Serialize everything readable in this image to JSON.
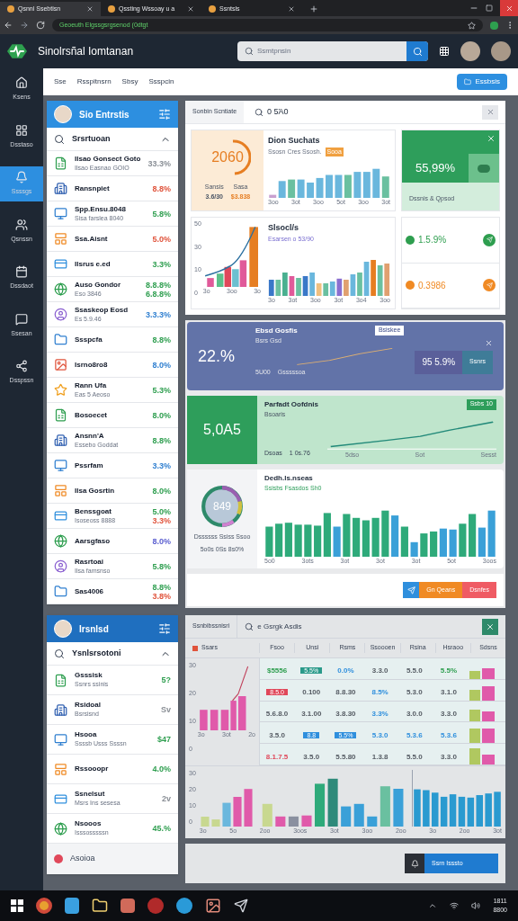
{
  "browser": {
    "tabs": [
      {
        "title": "Qsnnl Ssebtisn",
        "selected": true
      },
      {
        "title": "Qssting Wssoay  u a",
        "selected": false
      },
      {
        "title": "Ssntsls",
        "selected": false
      }
    ],
    "address": "Geoeuth Elgssgsrgsenod (0dtgt"
  },
  "app": {
    "title": "Sinolrsñal Iomtanan",
    "search_placeholder": "Ssmtpnsin"
  },
  "rail": [
    {
      "label": "Ksens",
      "selected": false
    },
    {
      "label": "Dsstaso",
      "selected": false
    },
    {
      "label": "Ssssgs",
      "selected": true
    },
    {
      "label": "Qsnssn",
      "selected": false
    },
    {
      "label": "Dssdaot",
      "selected": false
    },
    {
      "label": "Ssesan",
      "selected": false
    },
    {
      "label": "Dsspssn",
      "selected": false
    }
  ],
  "toolbar": {
    "links": [
      "Sse",
      "Rsspitnsrn",
      "Sbsy",
      "Ssspcin"
    ],
    "button": "Essbsis"
  },
  "list_top": {
    "title": "Sio Entrstis",
    "search_label": "Srsrtuoan",
    "items": [
      {
        "title": "Ilsao Gonsect Goto",
        "subtitle": "Ilsao Easnao  GOIO",
        "values": [
          {
            "text": "33.3%",
            "color": "#8a8f96"
          }
        ]
      },
      {
        "title": "Ransnpiet",
        "values": [
          {
            "text": "8.8%",
            "color": "#e0533b"
          }
        ]
      },
      {
        "title": "Spp.Ensu.8048",
        "subtitle": "Sisa farslea  8040",
        "values": [
          {
            "text": "5.8%",
            "color": "#2e9e4f"
          }
        ]
      },
      {
        "title": "Ssa.Aisnt",
        "values": [
          {
            "text": "5.0%",
            "color": "#e0533b"
          }
        ]
      },
      {
        "title": "Ilsrus e.ed",
        "values": [
          {
            "text": "3.3%",
            "color": "#2e9e4f"
          }
        ]
      },
      {
        "title": "Auso Gondor",
        "subtitle": "Eso 3846",
        "values": [
          {
            "text": "8.8.8%",
            "color": "#2e9e4f"
          },
          {
            "text": "6.8.8%",
            "color": "#2e9e4f"
          }
        ]
      },
      {
        "title": "Ssaskeop Eosd",
        "subtitle": "Es 5.9.46",
        "values": [
          {
            "text": "3.3.3%",
            "color": "#2f7fd0"
          }
        ]
      },
      {
        "title": "Ssspcfa",
        "values": [
          {
            "text": "8.8%",
            "color": "#2e9e4f"
          }
        ]
      },
      {
        "title": "Isrno8ro8",
        "values": [
          {
            "text": "8.0%",
            "color": "#2f7fd0"
          }
        ]
      },
      {
        "title": "Rann Ufa",
        "subtitle": "Eas 5 Aeoso",
        "values": [
          {
            "text": "5.3%",
            "color": "#2e9e4f"
          }
        ]
      },
      {
        "title": "Bosoecet",
        "values": [
          {
            "text": "8.0%",
            "color": "#2e9e4f"
          }
        ]
      },
      {
        "title": "Ansnn'A",
        "subtitle": "Essebo Goddat",
        "values": [
          {
            "text": "8.8%",
            "color": "#2e9e4f"
          }
        ]
      },
      {
        "title": "Pssrfam",
        "values": [
          {
            "text": "3.3%",
            "color": "#2f7fd0"
          }
        ]
      },
      {
        "title": "Ilsa Gosrtin",
        "values": [
          {
            "text": "8.0%",
            "color": "#2e9e4f"
          }
        ]
      },
      {
        "title": "Benssgoat",
        "subtitle": "Isoseoss 8888",
        "values": [
          {
            "text": "5.0%",
            "color": "#2e9e4f"
          },
          {
            "text": "3.3%",
            "color": "#e0533b"
          }
        ]
      },
      {
        "title": "Aarsgfaso",
        "values": [
          {
            "text": "8.0%",
            "color": "#5b5fd0"
          }
        ]
      },
      {
        "title": "Rasrtoai",
        "subtitle": "Ilsa famsnso",
        "values": [
          {
            "text": "5.8%",
            "color": "#2e9e4f"
          }
        ]
      },
      {
        "title": "Sas4006",
        "values": [
          {
            "text": "8.8%",
            "color": "#2e9e4f"
          },
          {
            "text": "3.8%",
            "color": "#e0533b"
          }
        ]
      }
    ]
  },
  "dashboard": {
    "tab": "Sonbin Scntiate",
    "query": "0 5Ά0",
    "gauge_card": {
      "value": "2060",
      "stats": [
        {
          "label": "Sansis",
          "value": "3.6/30"
        },
        {
          "label": "Sasa",
          "value": "$3.838"
        }
      ],
      "title": "Dion Suchats",
      "subtitle": "Ssosn Cres Ssosh.",
      "tag": "Sooa",
      "xlabels": [
        "3oo",
        "3ot",
        "3oo",
        "5ot",
        "3oo",
        "3ot"
      ]
    },
    "kpi_card": {
      "value": "55,99%",
      "footer": "Dssnis & Qpsod"
    },
    "line_card": {
      "title": "Slsocl/s",
      "subtitle": "Esarsen o 53/90",
      "ylabels": [
        "50",
        "30",
        "10",
        "0"
      ],
      "xlabels": [
        "3o",
        "3oo",
        "3o"
      ],
      "bar_xlabels": [
        "3o",
        "3ot",
        "3oo",
        "3ot",
        "3o4",
        "3oo"
      ]
    },
    "mini_stats": [
      {
        "value": "1.5.9%",
        "color": "#2e9e4f"
      },
      {
        "value": "0.3986",
        "color": "#f08a24"
      }
    ]
  },
  "trend_card": {
    "value": "22.%",
    "title": "Ebsd Gosfis",
    "subtitle": "Bsrs Gsd",
    "foot": [
      "5U00",
      "Gsssssoa"
    ],
    "tag": "Bsiskee",
    "side_value": "95 5.9%",
    "side_button": "Ssnrs"
  },
  "growth_card": {
    "value": "5,0A5",
    "title": "Parfadt Oofdnis",
    "subtitle": "Bsoaris",
    "foot": [
      "Dsoas",
      "1 0s.76"
    ],
    "tag": "Ssbs 10",
    "xlabels": [
      "5dso",
      "Sot",
      "Sesst"
    ]
  },
  "donut_card": {
    "value": "849",
    "title": "Dedh.ls.nseas",
    "subtitle": "Ssisbs Fsasdos Sh0",
    "legend": [
      "Dssssss Ssiss Ssoo",
      "5o0s 0Ss 8s0%"
    ],
    "xlabels": [
      "5o0",
      "3ots",
      "3ot",
      "3ot",
      "3ot",
      "5ot",
      "3oos"
    ]
  },
  "actions": [
    {
      "kind": "icon",
      "color": "#2f8fdd"
    },
    {
      "kind": "text",
      "label": "Gn Qeans",
      "color": "#f08a24"
    },
    {
      "kind": "text",
      "label": "Dsnfes",
      "color": "#ef5b64"
    }
  ],
  "list_bottom": {
    "title": "Irsnlsd",
    "search_label": "Ysnlsrsotoni",
    "items": [
      {
        "title": "Gsssisk",
        "subtitle": "Ssnrs ssinis",
        "values": [
          {
            "text": "5?",
            "color": "#2e9e4f"
          }
        ]
      },
      {
        "title": "Rsidoal",
        "subtitle": "Bsrsisnd",
        "values": [
          {
            "text": "Sv",
            "color": "#8a8f96"
          }
        ]
      },
      {
        "title": "Hsooa",
        "subtitle": "Ssssb Usss Ssssn",
        "values": [
          {
            "text": "$47",
            "color": "#2e9e4f"
          }
        ]
      },
      {
        "title": "Rssooopr",
        "values": [
          {
            "text": "4.0%",
            "color": "#2e9e4f"
          }
        ]
      },
      {
        "title": "Ssnelsut",
        "subtitle": "Msrs Ins sesesa",
        "values": [
          {
            "text": "2v",
            "color": "#8a8f96"
          }
        ]
      },
      {
        "title": "Nsooos",
        "subtitle": "Isssosssssn",
        "values": [
          {
            "text": "45.%",
            "color": "#2e9e4f"
          }
        ]
      }
    ],
    "footer": "Asoioa"
  },
  "report": {
    "tab": "Ssnbibssnisri",
    "query": "e Gsrgk Asdis",
    "series_label": "Ssars",
    "columns": [
      "Fsoo",
      "Unsi",
      "Rsms",
      "Ssoooen",
      "Rsina",
      "Hsraoo",
      "Sdsns"
    ],
    "rows": [
      [
        {
          "text": "$5556",
          "kind": "text",
          "color": "#2e9e4f"
        },
        {
          "text": "5.5%",
          "kind": "chip",
          "color": "#2a9a8a"
        },
        {
          "text": "0.0%",
          "kind": "text",
          "color": "#2f8fdd"
        },
        {
          "text": "3.3.0",
          "kind": "text",
          "color": "#555b63"
        },
        {
          "text": "5.5.0",
          "kind": "text",
          "color": "#555b63"
        },
        {
          "text": "5.5%",
          "kind": "text",
          "color": "#2e9e4f"
        }
      ],
      [
        {
          "text": "8.5.0",
          "kind": "chip",
          "color": "#e0485a"
        },
        {
          "text": "0.100",
          "kind": "text",
          "color": "#555b63"
        },
        {
          "text": "8.8.30",
          "kind": "text",
          "color": "#555b63"
        },
        {
          "text": "8.5%",
          "kind": "text",
          "color": "#2f8fdd"
        },
        {
          "text": "5.3.0",
          "kind": "text",
          "color": "#555b63"
        },
        {
          "text": "3.1.0",
          "kind": "text",
          "color": "#555b63"
        }
      ],
      [
        {
          "text": "5.6.8.0",
          "kind": "text",
          "color": "#555b63"
        },
        {
          "text": "3.1.00",
          "kind": "text",
          "color": "#555b63"
        },
        {
          "text": "3.8.30",
          "kind": "text",
          "color": "#555b63"
        },
        {
          "text": "3.3%",
          "kind": "text",
          "color": "#2f8fdd"
        },
        {
          "text": "3.0.0",
          "kind": "text",
          "color": "#555b63"
        },
        {
          "text": "3.3.0",
          "kind": "text",
          "color": "#555b63"
        }
      ],
      [
        {
          "text": "3.5.0",
          "kind": "text",
          "color": "#555b63"
        },
        {
          "text": "8.8",
          "kind": "chip",
          "color": "#2f8fdd"
        },
        {
          "text": "5.5%",
          "kind": "chip",
          "color": "#2f8fdd"
        },
        {
          "text": "5.3.0",
          "kind": "text",
          "color": "#2f8fdd"
        },
        {
          "text": "5.3.6",
          "kind": "text",
          "color": "#2f8fdd"
        },
        {
          "text": "5.3.6",
          "kind": "text",
          "color": "#2f8fdd"
        }
      ],
      [
        {
          "text": "8.1.7.5",
          "kind": "text",
          "color": "#e0485a"
        },
        {
          "text": "3.5.0",
          "kind": "text",
          "color": "#555b63"
        },
        {
          "text": "5.5.80",
          "kind": "text",
          "color": "#555b63"
        },
        {
          "text": "1.3.8",
          "kind": "text",
          "color": "#555b63"
        },
        {
          "text": "5.5.0",
          "kind": "text",
          "color": "#555b63"
        },
        {
          "text": "3.3.0",
          "kind": "text",
          "color": "#555b63"
        }
      ]
    ],
    "chart_ylabels": [
      "30",
      "20",
      "10",
      "0"
    ],
    "chart_xlabels": [
      "3o",
      "3ot",
      "2o"
    ],
    "bottom_ylabels": [
      "30",
      "20",
      "10",
      "0"
    ],
    "bottom_xlabels": [
      "3o",
      "5o",
      "2oo",
      "3oos",
      "3ot",
      "3oo",
      "2oo",
      "3o",
      "2oo",
      "3ot"
    ]
  },
  "bottom_bar": {
    "button": "Ssrn Isssto"
  },
  "clock": [
    "1811",
    "8800"
  ]
}
